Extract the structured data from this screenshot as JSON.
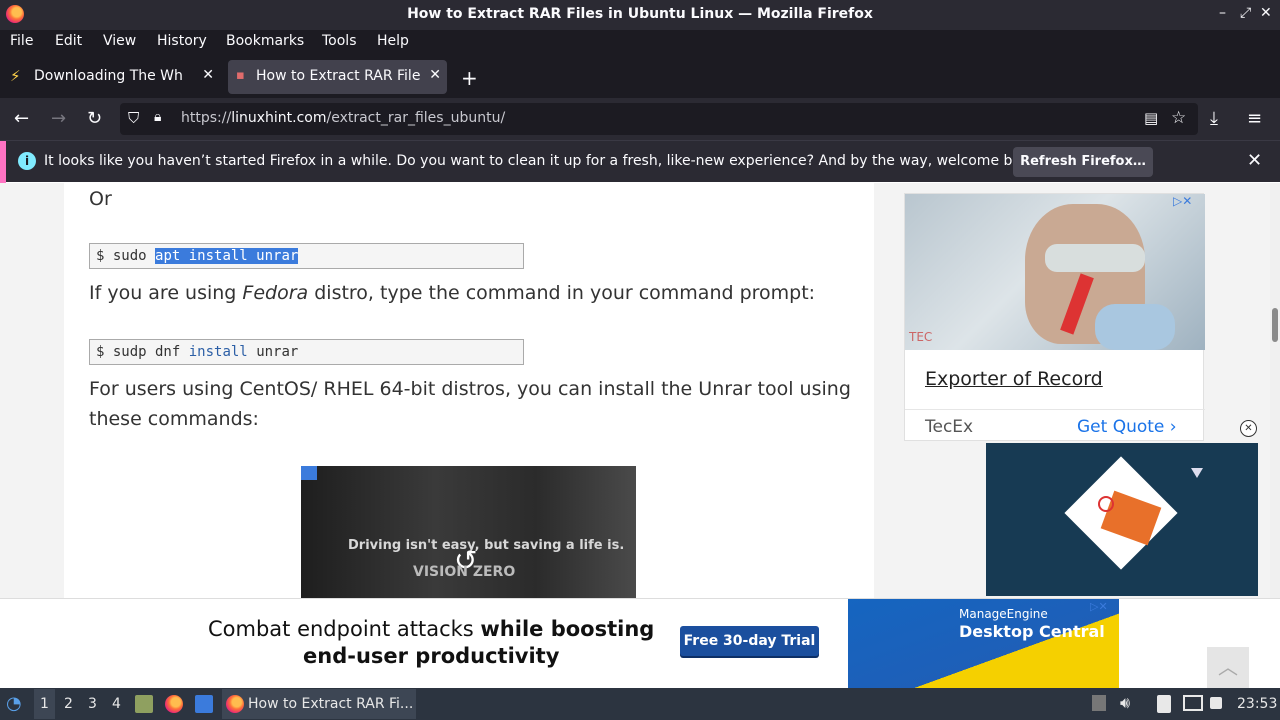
{
  "window": {
    "title": "How to Extract RAR Files in Ubuntu Linux — Mozilla Firefox",
    "controls": [
      "–",
      "⤢",
      "✕"
    ]
  },
  "menu": [
    "File",
    "Edit",
    "View",
    "History",
    "Bookmarks",
    "Tools",
    "Help"
  ],
  "tabs": [
    {
      "label": "Downloading The White House"
    },
    {
      "label": "How to Extract RAR Files in Ubuntu Linux"
    }
  ],
  "nav": {
    "url_prefix": "https://",
    "url_domain": "linuxhint.com",
    "url_path": "/extract_rar_files_ubuntu/"
  },
  "notice": {
    "message": "It looks like you haven’t started Firefox in a while. Do you want to clean it up for a fresh, like-new experience? And by the way, welcome back!",
    "button": "Refresh Firefox…"
  },
  "article": {
    "or_text": "Or",
    "code1": {
      "prompt": "$ sudo",
      "selected": "apt install unrar"
    },
    "fedora": {
      "before": "If you are using ",
      "em": "Fedora",
      "after": " distro, type the command in your command prompt:"
    },
    "code2": {
      "prompt": "$ sudp dnf",
      "kw": "install",
      "rest": "unrar"
    },
    "centos_line1": "For users using CentOS/ RHEL 64-bit distros, you can install the Unrar tool using",
    "centos_line2": "these commands:",
    "video": {
      "caption": "Driving isn't easy, but saving a life is.",
      "brand": "VISION ZERO"
    }
  },
  "side_ad": {
    "logo": "TEC",
    "title": "Exporter of Record",
    "advertiser": "TecEx",
    "cta": "Get Quote"
  },
  "bottom_ad": {
    "line1_plain": "Combat endpoint attacks ",
    "line1_bold": "while boosting",
    "line2": "end-user productivity",
    "cta": "Free 30-day Trial",
    "brand_small": "ManageEngine",
    "brand_big": "Desktop Central"
  },
  "taskbar": {
    "workspaces": [
      "1",
      "2",
      "3",
      "4"
    ],
    "window_label": "How to Extract RAR Fi...",
    "clock": "23:53"
  },
  "colors": {
    "accent": "#3b7bdc",
    "notice_stripe": "#ff73c3",
    "info": "#80ebff"
  }
}
